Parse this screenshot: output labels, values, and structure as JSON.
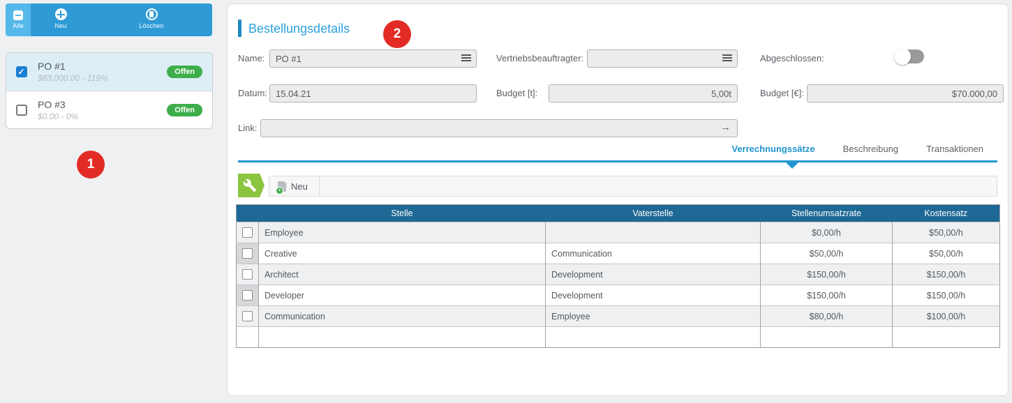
{
  "annotations": {
    "marker1": "1",
    "marker2": "2"
  },
  "sidebar": {
    "toolbar": {
      "alle_label": "Alle",
      "neu_label": "Neu",
      "loeschen_label": "Löschen"
    },
    "items": [
      {
        "title": "PO #1",
        "subtitle": "$83,000.00 - 119%",
        "badge": "Offen",
        "checked": true
      },
      {
        "title": "PO #3",
        "subtitle": "$0.00 - 0%",
        "badge": "Offen",
        "checked": false
      }
    ]
  },
  "details": {
    "title": "Bestellungsdetails",
    "fields": {
      "name": {
        "label": "Name:",
        "value": "PO #1"
      },
      "vertriebsbeauftragter": {
        "label": "Vertriebsbeauftragter:",
        "value": ""
      },
      "abgeschlossen": {
        "label": "Abgeschlossen:",
        "state": "off"
      },
      "datum": {
        "label": "Datum:",
        "value": "15.04.21"
      },
      "budget_t": {
        "label": "Budget [t]:",
        "value": "5,00t"
      },
      "budget_eur": {
        "label": "Budget [€]:",
        "value": "$70.000,00"
      },
      "link": {
        "label": "Link:",
        "value": ""
      }
    },
    "tabs": [
      {
        "label": "Verrechnungssätze",
        "active": true
      },
      {
        "label": "Beschreibung",
        "active": false
      },
      {
        "label": "Transaktionen",
        "active": false
      }
    ],
    "ribbon": {
      "neu_label": "Neu"
    },
    "table": {
      "headers": [
        "Stelle",
        "Vaterstelle",
        "Stellenumsatzrate",
        "Kostensatz"
      ],
      "rows": [
        {
          "stelle": "Employee",
          "vaterstelle": "",
          "rate": "$0,00/h",
          "kostensatz": "$50,00/h"
        },
        {
          "stelle": "Creative",
          "vaterstelle": "Communication",
          "rate": "$50,00/h",
          "kostensatz": "$50,00/h"
        },
        {
          "stelle": "Architect",
          "vaterstelle": "Development",
          "rate": "$150,00/h",
          "kostensatz": "$150,00/h"
        },
        {
          "stelle": "Developer",
          "vaterstelle": "Development",
          "rate": "$150,00/h",
          "kostensatz": "$150,00/h"
        },
        {
          "stelle": "Communication",
          "vaterstelle": "Employee",
          "rate": "$80,00/h",
          "kostensatz": "$100,00/h"
        }
      ]
    }
  },
  "colors": {
    "toolbar_blue": "#2f9ad5",
    "toolbar_active_blue": "#55b8ea",
    "selection_blue": "#ddeef7",
    "badge_green": "#3eae4b",
    "wrench_green": "#8bc540",
    "table_header_blue": "#1e6896",
    "accent_blue": "#2196cf",
    "marker_red": "#e32b25"
  }
}
